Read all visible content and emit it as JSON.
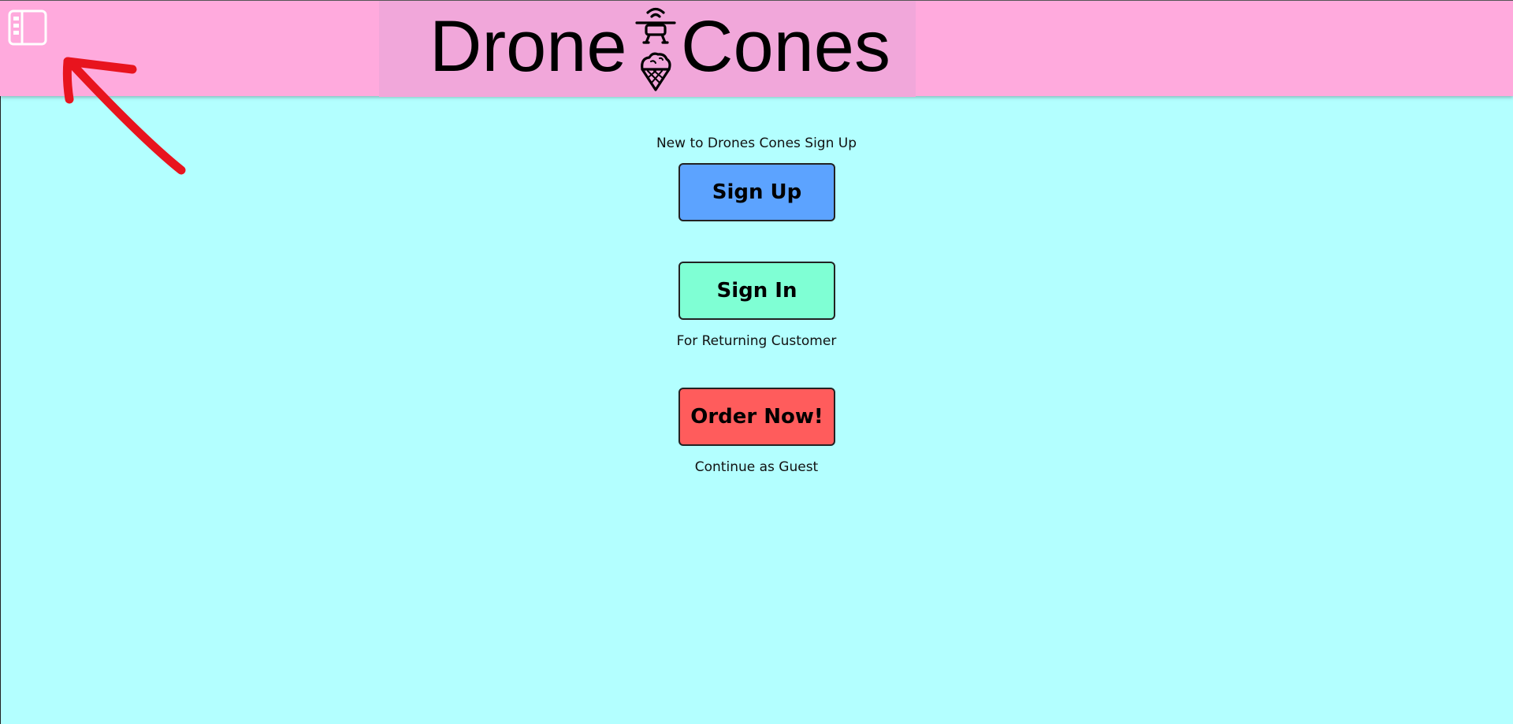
{
  "header": {
    "logo_word_left": "Drone",
    "logo_word_right": "Cones",
    "logo_icon": "drone-ice-cream-icon",
    "sidebar_toggle_icon": "sidebar-toggle-icon",
    "colors": {
      "header_bg": "#ffaadd",
      "logo_panel_bg": "#f1a7da"
    }
  },
  "main": {
    "background": "#b3ffff",
    "signup_caption": "New to Drones Cones Sign Up",
    "signup_label": "Sign Up",
    "signup_color": "#5ca3ff",
    "signin_label": "Sign In",
    "signin_color": "#7fffd4",
    "signin_caption": "For Returning Customer",
    "order_label": "Order Now!",
    "order_color": "#ff5c5c",
    "order_caption": "Continue as Guest"
  },
  "annotation": {
    "arrow_icon": "red-arrow-annotation",
    "arrow_color": "#e8141e"
  }
}
